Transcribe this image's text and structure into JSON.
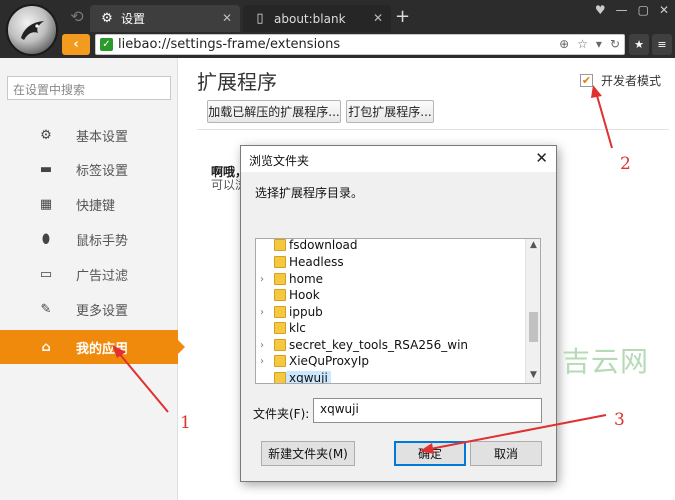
{
  "browser": {
    "tabs": [
      {
        "label": "设置",
        "icon": "gear-icon"
      },
      {
        "label": "about:blank",
        "icon": "page-icon"
      }
    ],
    "new_tab": "+",
    "window_controls": [
      "♥",
      "—",
      "▢",
      "✕"
    ],
    "address": "liebao://settings-frame/extensions",
    "back_glyph": "‹"
  },
  "sidebar": {
    "search_placeholder": "在设置中搜索",
    "items": [
      {
        "label": "基本设置",
        "icon": "gear-icon"
      },
      {
        "label": "标签设置",
        "icon": "laptop-icon"
      },
      {
        "label": "快捷键",
        "icon": "keyboard-icon"
      },
      {
        "label": "鼠标手势",
        "icon": "mouse-icon"
      },
      {
        "label": "广告过滤",
        "icon": "window-icon"
      },
      {
        "label": "更多设置",
        "icon": "wrench-icon"
      },
      {
        "label": "我的应用",
        "icon": "home-icon",
        "active": true
      }
    ]
  },
  "main": {
    "title": "扩展程序",
    "dev_mode_label": "开发者模式",
    "dev_mode_checked": true,
    "load_unpacked_label": "加载已解压的扩展程序...",
    "pack_label": "打包扩展程序...",
    "empty_line1": "啊哦，",
    "empty_line2": "可以浏"
  },
  "dialog": {
    "title": "浏览文件夹",
    "close": "✕",
    "prompt": "选择扩展程序目录。",
    "tree": [
      {
        "label": "fsdownload",
        "expandable": false
      },
      {
        "label": "Headless",
        "expandable": false
      },
      {
        "label": "home",
        "expandable": true
      },
      {
        "label": "Hook",
        "expandable": false
      },
      {
        "label": "ippub",
        "expandable": true
      },
      {
        "label": "klc",
        "expandable": false
      },
      {
        "label": "secret_key_tools_RSA256_win",
        "expandable": true
      },
      {
        "label": "XieQuProxyIp",
        "expandable": true
      },
      {
        "label": "xqwuji",
        "expandable": false,
        "selected": true
      }
    ],
    "folder_label": "文件夹(F):",
    "folder_value": "xqwuji",
    "new_folder_label": "新建文件夹(M)",
    "ok_label": "确定",
    "cancel_label": "取消"
  },
  "annotations": {
    "accent_color": "#e03030",
    "step1": "1",
    "step2": "2",
    "step3": "3"
  },
  "watermark": "吉云网",
  "colors": {
    "brand_orange": "#f08a0c",
    "chrome_dark": "#2c2c2c"
  }
}
